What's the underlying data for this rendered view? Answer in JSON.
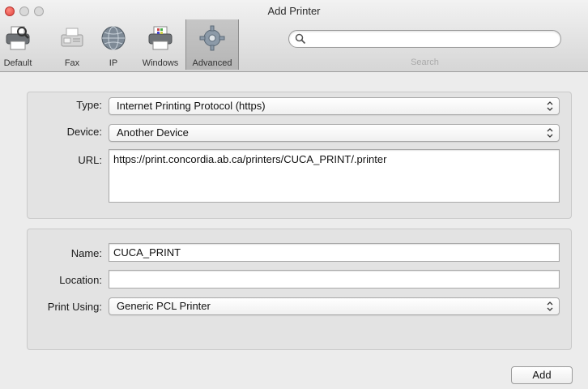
{
  "window": {
    "title": "Add Printer"
  },
  "toolbar": {
    "items": [
      {
        "label": "Default",
        "icon": "printer-icon"
      },
      {
        "label": "Fax",
        "icon": "fax-icon"
      },
      {
        "label": "IP",
        "icon": "globe-icon"
      },
      {
        "label": "Windows",
        "icon": "windows-printer-icon"
      },
      {
        "label": "Advanced",
        "icon": "gear-icon",
        "selected": true
      }
    ]
  },
  "search": {
    "label": "Search",
    "value": ""
  },
  "connection": {
    "type_label": "Type:",
    "type_value": "Internet Printing Protocol (https)",
    "device_label": "Device:",
    "device_value": "Another Device",
    "url_label": "URL:",
    "url_value": "https://print.concordia.ab.ca/printers/CUCA_PRINT/.printer"
  },
  "printer": {
    "name_label": "Name:",
    "name_value": "CUCA_PRINT",
    "location_label": "Location:",
    "location_value": "",
    "print_using_label": "Print Using:",
    "print_using_value": "Generic PCL Printer"
  },
  "actions": {
    "add_label": "Add"
  },
  "colors": {
    "close": "#e0443e",
    "window_bg": "#ececec",
    "panel_bg": "#e3e3e3"
  }
}
